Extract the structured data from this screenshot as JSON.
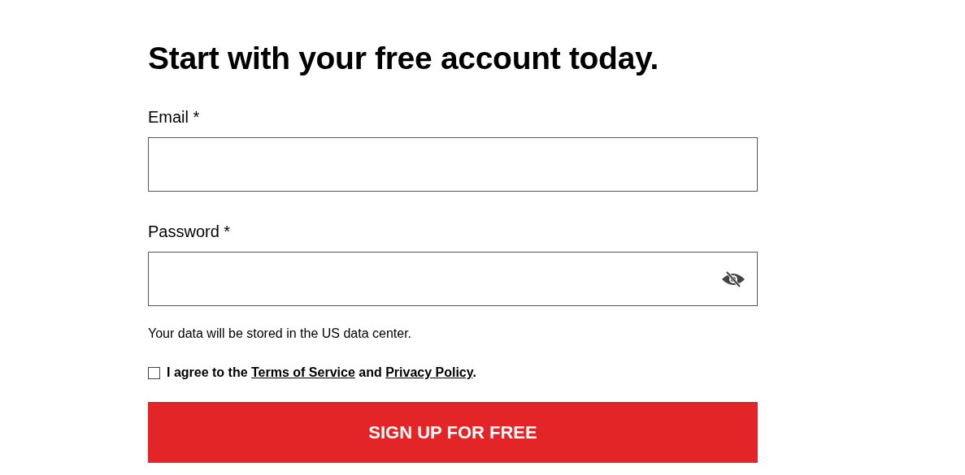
{
  "heading": "Start with your free account today.",
  "fields": [
    {
      "kind": "email",
      "label": "Email *"
    },
    {
      "kind": "password",
      "label": "Password *"
    }
  ],
  "note": "Your data will be stored in the US data center.",
  "agreement": {
    "checked": false,
    "parts": [
      {
        "kind": "text",
        "text": "I agree to the "
      },
      {
        "kind": "link",
        "text": "Terms of Service"
      },
      {
        "kind": "text",
        "text": " and "
      },
      {
        "kind": "link",
        "text": "Privacy Policy"
      },
      {
        "kind": "text",
        "text": "."
      }
    ]
  },
  "submit": "SIGN UP FOR FREE"
}
